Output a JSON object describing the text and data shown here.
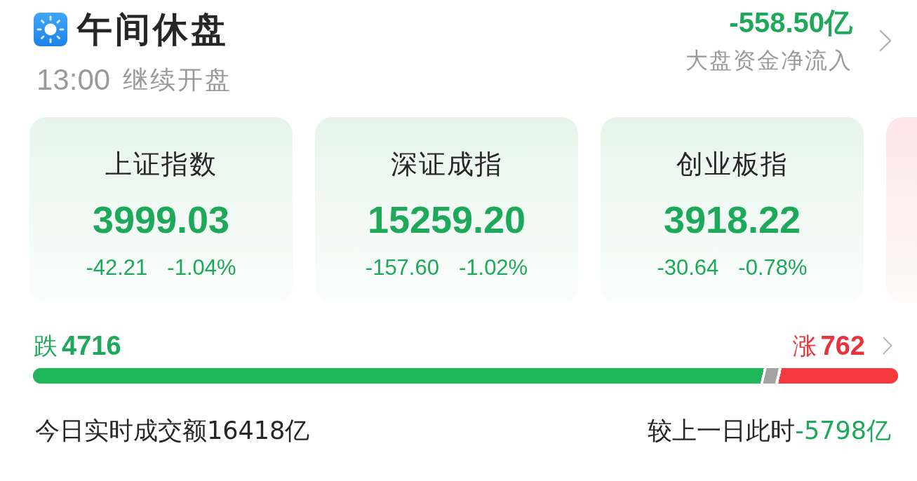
{
  "header": {
    "title": "午间休盘",
    "resume_time": "13:00",
    "resume_label": "继续开盘"
  },
  "net_inflow": {
    "amount": "-558.50亿",
    "rising": false,
    "label": "大盘资金净流入"
  },
  "index_cards": [
    {
      "name": "上证指数",
      "value": "3999.03",
      "change": "-42.21",
      "change_pct": "-1.04%",
      "rising": false
    },
    {
      "name": "深证成指",
      "value": "15259.20",
      "change": "-157.60",
      "change_pct": "-1.02%",
      "rising": false
    },
    {
      "name": "创业板指",
      "value": "3918.22",
      "change": "-30.64",
      "change_pct": "-0.78%",
      "rising": false
    },
    {
      "rising": true
    }
  ],
  "breadth": {
    "fall": {
      "label": "跌",
      "count": "4716"
    },
    "rise": {
      "label": "涨",
      "count": "762"
    }
  },
  "breadth_bar": {
    "falling": {
      "level": 0.848
    },
    "rising": {
      "level": 0.142
    }
  },
  "turnover": {
    "text": "今日实时成交额16418亿",
    "compare_label": "较上一日此时",
    "compare_value": "-5798亿",
    "compare_rising": false
  }
}
